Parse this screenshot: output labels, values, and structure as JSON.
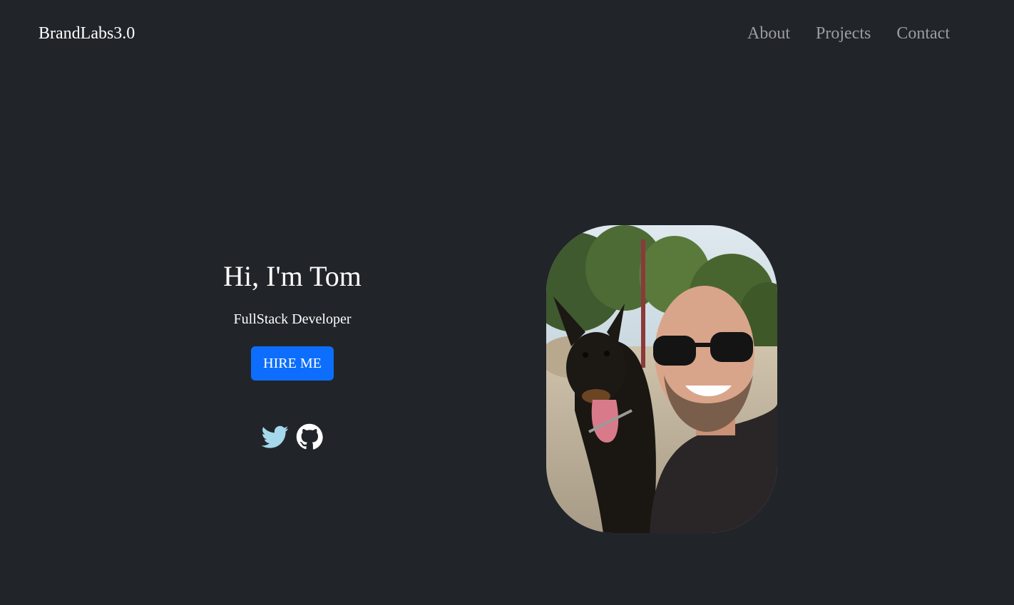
{
  "navbar": {
    "brand": "BrandLabs3.0",
    "links": [
      {
        "label": "About"
      },
      {
        "label": "Projects"
      },
      {
        "label": "Contact"
      }
    ]
  },
  "hero": {
    "title": "Hi, I'm Tom",
    "subtitle": "FullStack Developer",
    "hire_button": "HIRE ME",
    "socials": [
      {
        "icon": "twitter-icon",
        "color": "#a6d8ec"
      },
      {
        "icon": "github-icon",
        "color": "#ffffff"
      }
    ],
    "photo": {
      "icon": "profile-photo"
    }
  },
  "colors": {
    "background": "#212529",
    "accent": "#0d6efd",
    "nav_link": "rgba(255,255,255,0.55)"
  }
}
